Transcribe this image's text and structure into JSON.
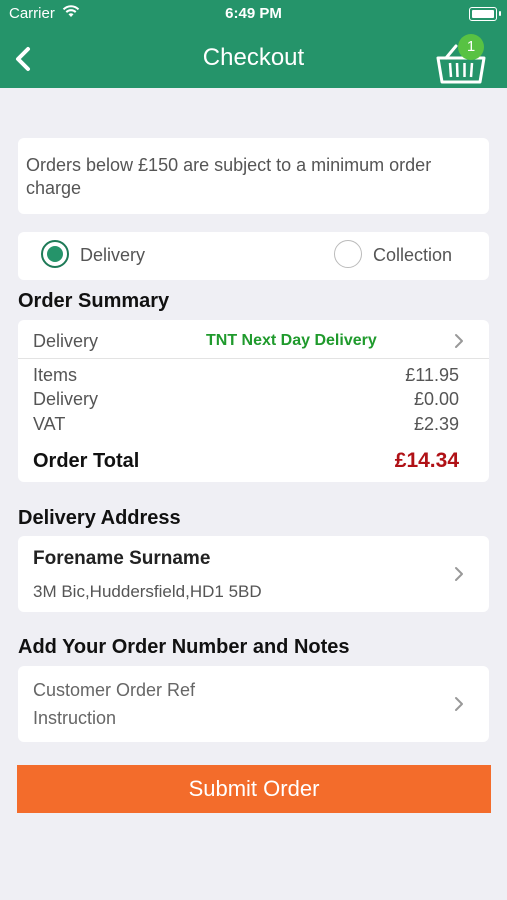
{
  "status_bar": {
    "carrier": "Carrier",
    "time": "6:49 PM"
  },
  "nav": {
    "title": "Checkout",
    "cart_count": "1",
    "icons": [
      "back-icon",
      "basket-icon"
    ]
  },
  "notice": {
    "text": "Orders below £150 are subject to a minimum order charge"
  },
  "fulfilment": {
    "options": [
      {
        "label": "Delivery",
        "selected": true
      },
      {
        "label": "Collection",
        "selected": false
      }
    ]
  },
  "order_summary": {
    "title": "Order Summary",
    "delivery_label": "Delivery",
    "delivery_method": "TNT Next Day Delivery",
    "lines": [
      {
        "label": "Items",
        "value": "£11.95"
      },
      {
        "label": "Delivery",
        "value": "£0.00"
      },
      {
        "label": "VAT",
        "value": "£2.39"
      }
    ],
    "total_label": "Order Total",
    "total_value": "£14.34"
  },
  "delivery_address": {
    "title": "Delivery Address",
    "name": "Forename Surname",
    "address": "3M Bic,Huddersfield,HD1 5BD"
  },
  "notes": {
    "title": "Add Your Order Number and Notes",
    "ref_placeholder": "Customer Order Ref",
    "instruction_placeholder": "Instruction"
  },
  "submit_label": "Submit Order",
  "colors": {
    "brand": "#25946a",
    "submit": "#f36c2b",
    "total": "#b01116",
    "delivery_method": "#1f9a2c"
  }
}
